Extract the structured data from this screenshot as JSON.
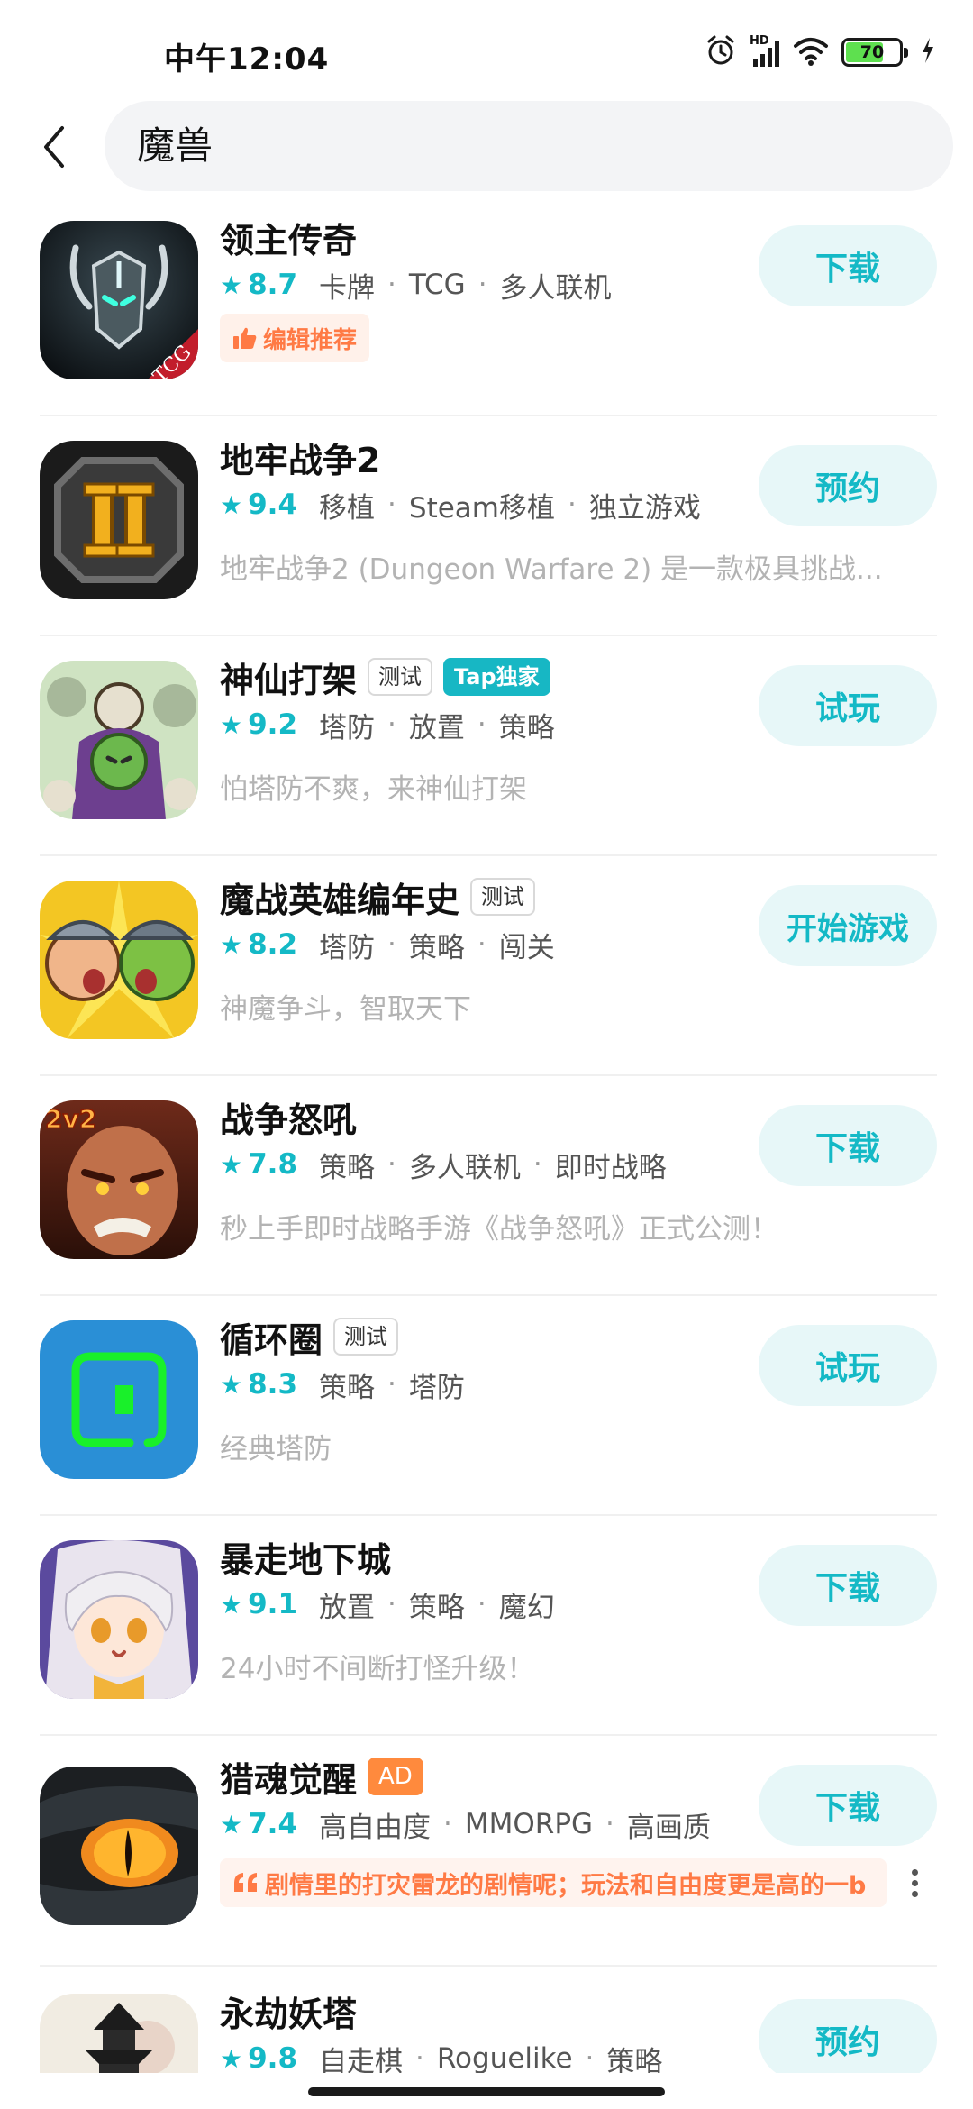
{
  "status_bar": {
    "time": "中午12:04",
    "network_label": "HD",
    "battery_level": "70",
    "battery_fraction": 0.7,
    "icons": [
      "alarm-icon",
      "signal-icon",
      "wifi-icon",
      "battery-icon",
      "charging-icon"
    ]
  },
  "search": {
    "query": "魔兽",
    "back_icon": "chevron-left-icon"
  },
  "colors": {
    "accent": "#14b9c6",
    "button_bg": "#e7f7f8",
    "badge_orange": "#ff7a45",
    "ad_tag": "#ff8a3d"
  },
  "apps": [
    {
      "title": "领主传奇",
      "tags": [],
      "rating": "8.7",
      "categories": [
        "卡牌",
        "TCG",
        "多人联机"
      ],
      "badge": "编辑推荐",
      "action": "下载",
      "icon_label": "TCG"
    },
    {
      "title": "地牢战争2",
      "tags": [],
      "rating": "9.4",
      "categories": [
        "移植",
        "Steam移植",
        "独立游戏"
      ],
      "description": "地牢战争2 (Dungeon Warfare 2) 是一款极具挑战...",
      "action": "预约"
    },
    {
      "title": "神仙打架",
      "tags": [
        "测试",
        "Tap独家"
      ],
      "rating": "9.2",
      "categories": [
        "塔防",
        "放置",
        "策略"
      ],
      "description": "怕塔防不爽，来神仙打架",
      "action": "试玩"
    },
    {
      "title": "魔战英雄编年史",
      "tags": [
        "测试"
      ],
      "rating": "8.2",
      "categories": [
        "塔防",
        "策略",
        "闯关"
      ],
      "description": "神魔争斗，智取天下",
      "action": "开始游戏"
    },
    {
      "title": "战争怒吼",
      "tags": [],
      "rating": "7.8",
      "categories": [
        "策略",
        "多人联机",
        "即时战略"
      ],
      "description": "秒上手即时战略手游《战争怒吼》正式公测！",
      "action": "下载",
      "icon_label": "2v2"
    },
    {
      "title": "循环圈",
      "tags": [
        "测试"
      ],
      "rating": "8.3",
      "categories": [
        "策略",
        "塔防"
      ],
      "description": "经典塔防",
      "action": "试玩"
    },
    {
      "title": "暴走地下城",
      "tags": [],
      "rating": "9.1",
      "categories": [
        "放置",
        "策略",
        "魔幻"
      ],
      "description": "24小时不间断打怪升级！",
      "action": "下载"
    },
    {
      "title": "猎魂觉醒",
      "tags": [
        "AD"
      ],
      "rating": "7.4",
      "categories": [
        "高自由度",
        "MMORPG",
        "高画质"
      ],
      "review": "剧情里的打灾雷龙的剧情呢；玩法和自由度更是高的一b",
      "action": "下载"
    },
    {
      "title": "永劫妖塔",
      "tags": [],
      "rating": "9.8",
      "categories": [
        "自走棋",
        "Roguelike",
        "策略"
      ],
      "action": "预约"
    }
  ]
}
